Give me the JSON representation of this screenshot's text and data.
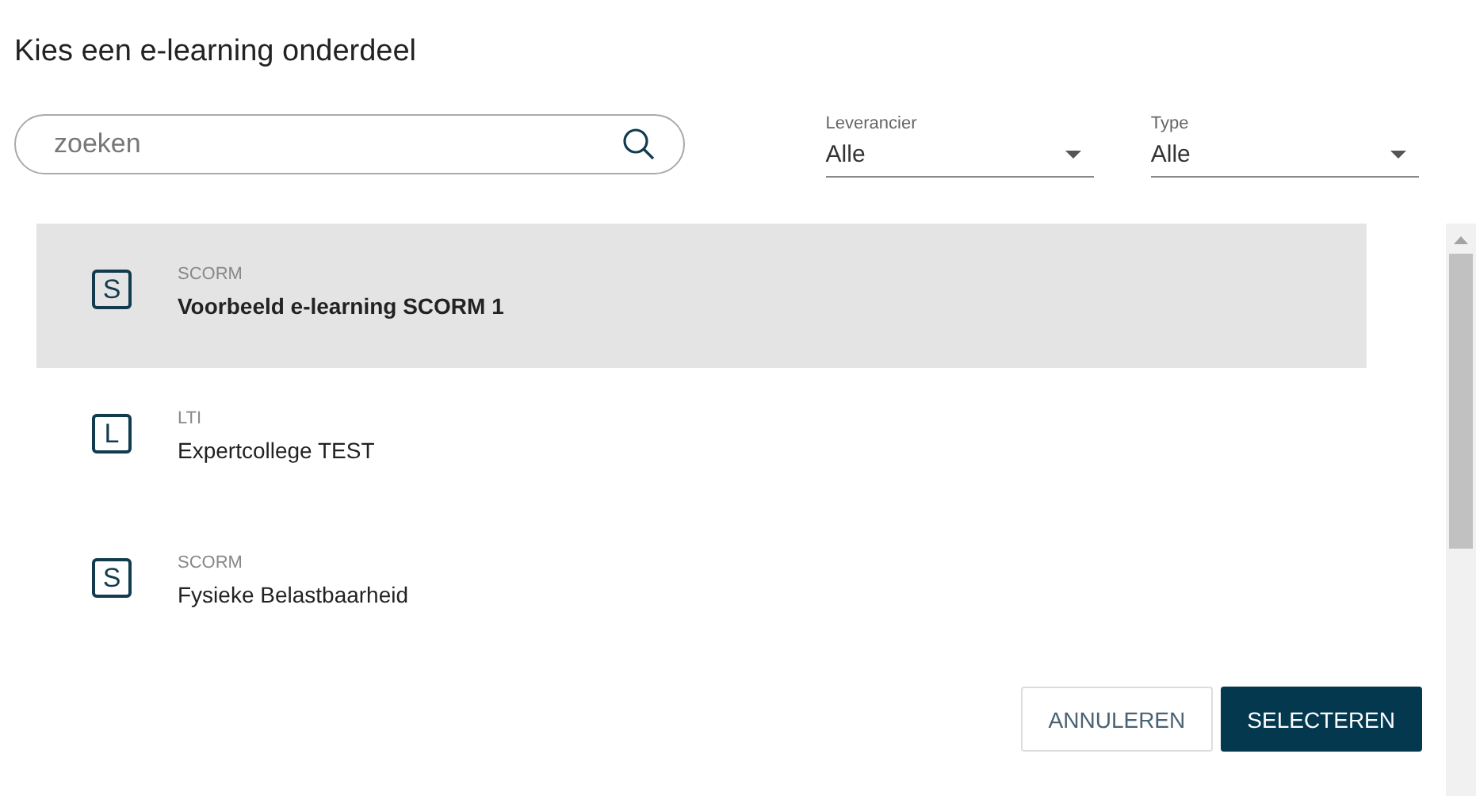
{
  "title": "Kies een e-learning onderdeel",
  "search": {
    "placeholder": "zoeken"
  },
  "filters": [
    {
      "label": "Leverancier",
      "value": "Alle"
    },
    {
      "label": "Type",
      "value": "Alle"
    }
  ],
  "items": [
    {
      "letter": "S",
      "type": "SCORM",
      "name": "Voorbeeld e-learning SCORM 1",
      "selected": true
    },
    {
      "letter": "L",
      "type": "LTI",
      "name": "Expertcollege TEST",
      "selected": false
    },
    {
      "letter": "S",
      "type": "SCORM",
      "name": "Fysieke Belastbaarheid",
      "selected": false
    }
  ],
  "buttons": [
    {
      "label": "ANNULEREN",
      "kind": "secondary"
    },
    {
      "label": "SELECTEREN",
      "kind": "primary"
    }
  ]
}
